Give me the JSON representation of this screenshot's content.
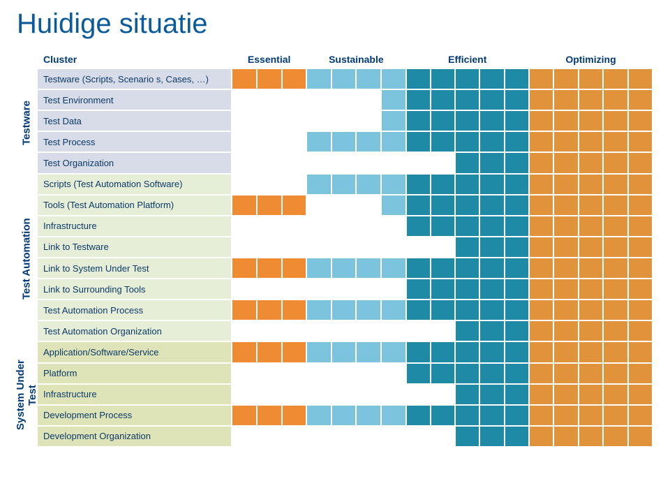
{
  "title": "Huidige situatie",
  "columns": {
    "cluster": "Cluster",
    "essential": "Essential",
    "sustainable": "Sustainable",
    "efficient": "Efficient",
    "optimizing": "Optimizing"
  },
  "verticals": {
    "testware": "Testware",
    "test_automation": "Test Automation",
    "system_under_test": "System Under\nTest"
  },
  "groups": {
    "essential_cols": 3,
    "sustainable_cols": 4,
    "efficient_cols": 5,
    "optimizing_cols": 5
  },
  "rows": [
    {
      "cluster": "testware",
      "label": "Testware (Scripts, Scenario s, Cases, …)",
      "css": "tw-lbl",
      "fill": {
        "essential": [
          1,
          1,
          1
        ],
        "sustainable": [
          1,
          1,
          1,
          1
        ],
        "efficient": [
          1,
          1,
          1,
          1,
          1
        ],
        "optimizing": [
          1,
          1,
          1,
          1,
          1
        ]
      }
    },
    {
      "cluster": "testware",
      "label": "Test Environment",
      "css": "tw-lbl",
      "fill": {
        "essential": [
          0,
          0,
          0
        ],
        "sustainable": [
          0,
          0,
          0,
          1
        ],
        "efficient": [
          1,
          1,
          1,
          1,
          1
        ],
        "optimizing": [
          1,
          1,
          1,
          1,
          1
        ]
      }
    },
    {
      "cluster": "testware",
      "label": "Test Data",
      "css": "tw-lbl",
      "fill": {
        "essential": [
          0,
          0,
          0
        ],
        "sustainable": [
          0,
          0,
          0,
          1
        ],
        "efficient": [
          1,
          1,
          1,
          1,
          1
        ],
        "optimizing": [
          1,
          1,
          1,
          1,
          1
        ]
      }
    },
    {
      "cluster": "testware",
      "label": "Test Process",
      "css": "tw-lbl",
      "fill": {
        "essential": [
          0,
          0,
          0
        ],
        "sustainable": [
          1,
          1,
          1,
          1
        ],
        "efficient": [
          1,
          1,
          1,
          1,
          1
        ],
        "optimizing": [
          1,
          1,
          1,
          1,
          1
        ]
      }
    },
    {
      "cluster": "testware",
      "label": "Test Organization",
      "css": "tw-lbl",
      "fill": {
        "essential": [
          0,
          0,
          0
        ],
        "sustainable": [
          0,
          0,
          0,
          0
        ],
        "efficient": [
          0,
          0,
          1,
          1,
          1
        ],
        "optimizing": [
          1,
          1,
          1,
          1,
          1
        ]
      }
    },
    {
      "cluster": "test_automation",
      "label": "Scripts (Test Automation Software)",
      "css": "ta-lbl",
      "fill": {
        "essential": [
          0,
          0,
          0
        ],
        "sustainable": [
          1,
          1,
          1,
          1
        ],
        "efficient": [
          1,
          1,
          1,
          1,
          1
        ],
        "optimizing": [
          1,
          1,
          1,
          1,
          1
        ]
      }
    },
    {
      "cluster": "test_automation",
      "label": "Tools (Test Automation Platform)",
      "css": "ta-lbl",
      "fill": {
        "essential": [
          1,
          1,
          1
        ],
        "sustainable": [
          0,
          0,
          0,
          1
        ],
        "efficient": [
          1,
          1,
          1,
          1,
          1
        ],
        "optimizing": [
          1,
          1,
          1,
          1,
          1
        ]
      }
    },
    {
      "cluster": "test_automation",
      "label": "Infrastructure",
      "css": "ta-lbl",
      "fill": {
        "essential": [
          0,
          0,
          0
        ],
        "sustainable": [
          0,
          0,
          0,
          0
        ],
        "efficient": [
          1,
          1,
          1,
          1,
          1
        ],
        "optimizing": [
          1,
          1,
          1,
          1,
          1
        ]
      }
    },
    {
      "cluster": "test_automation",
      "label": "Link to Testware",
      "css": "ta-lbl",
      "fill": {
        "essential": [
          0,
          0,
          0
        ],
        "sustainable": [
          0,
          0,
          0,
          0
        ],
        "efficient": [
          0,
          0,
          1,
          1,
          1
        ],
        "optimizing": [
          1,
          1,
          1,
          1,
          1
        ]
      }
    },
    {
      "cluster": "test_automation",
      "label": "Link to System Under Test",
      "css": "ta-lbl",
      "fill": {
        "essential": [
          1,
          1,
          1
        ],
        "sustainable": [
          1,
          1,
          1,
          1
        ],
        "efficient": [
          1,
          1,
          1,
          1,
          1
        ],
        "optimizing": [
          1,
          1,
          1,
          1,
          1
        ]
      }
    },
    {
      "cluster": "test_automation",
      "label": "Link to Surrounding Tools",
      "css": "ta-lbl",
      "fill": {
        "essential": [
          0,
          0,
          0
        ],
        "sustainable": [
          0,
          0,
          0,
          0
        ],
        "efficient": [
          1,
          1,
          1,
          1,
          1
        ],
        "optimizing": [
          1,
          1,
          1,
          1,
          1
        ]
      }
    },
    {
      "cluster": "test_automation",
      "label": "Test Automation Process",
      "css": "ta-lbl",
      "fill": {
        "essential": [
          1,
          1,
          1
        ],
        "sustainable": [
          1,
          1,
          1,
          1
        ],
        "efficient": [
          1,
          1,
          1,
          1,
          1
        ],
        "optimizing": [
          1,
          1,
          1,
          1,
          1
        ]
      }
    },
    {
      "cluster": "test_automation",
      "label": "Test Automation Organization",
      "css": "ta-lbl",
      "fill": {
        "essential": [
          0,
          0,
          0
        ],
        "sustainable": [
          0,
          0,
          0,
          0
        ],
        "efficient": [
          0,
          0,
          1,
          1,
          1
        ],
        "optimizing": [
          1,
          1,
          1,
          1,
          1
        ]
      }
    },
    {
      "cluster": "system_under_test",
      "label": "Application/Software/Service",
      "css": "sut-lbl",
      "fill": {
        "essential": [
          1,
          1,
          1
        ],
        "sustainable": [
          1,
          1,
          1,
          1
        ],
        "efficient": [
          1,
          1,
          1,
          1,
          1
        ],
        "optimizing": [
          1,
          1,
          1,
          1,
          1
        ]
      }
    },
    {
      "cluster": "system_under_test",
      "label": "Platform",
      "css": "sut-lbl",
      "fill": {
        "essential": [
          0,
          0,
          0
        ],
        "sustainable": [
          0,
          0,
          0,
          0
        ],
        "efficient": [
          1,
          1,
          1,
          1,
          1
        ],
        "optimizing": [
          1,
          1,
          1,
          1,
          1
        ]
      }
    },
    {
      "cluster": "system_under_test",
      "label": "Infrastructure",
      "css": "sut-lbl",
      "fill": {
        "essential": [
          0,
          0,
          0
        ],
        "sustainable": [
          0,
          0,
          0,
          0
        ],
        "efficient": [
          0,
          0,
          1,
          1,
          1
        ],
        "optimizing": [
          1,
          1,
          1,
          1,
          1
        ]
      }
    },
    {
      "cluster": "system_under_test",
      "label": "Development Process",
      "css": "sut-lbl",
      "fill": {
        "essential": [
          1,
          1,
          1
        ],
        "sustainable": [
          1,
          1,
          1,
          1
        ],
        "efficient": [
          1,
          1,
          1,
          1,
          1
        ],
        "optimizing": [
          1,
          1,
          1,
          1,
          1
        ]
      }
    },
    {
      "cluster": "system_under_test",
      "label": "Development Organization",
      "css": "sut-lbl",
      "fill": {
        "essential": [
          0,
          0,
          0
        ],
        "sustainable": [
          0,
          0,
          0,
          0
        ],
        "efficient": [
          0,
          0,
          1,
          1,
          1
        ],
        "optimizing": [
          1,
          1,
          1,
          1,
          1
        ]
      }
    }
  ],
  "colors": {
    "essential": "#ef8b33",
    "sustainable": "#7cc4dd",
    "efficient": "#1f8aa6",
    "optimizing": "#e1933c",
    "blank": "#ffffff"
  }
}
